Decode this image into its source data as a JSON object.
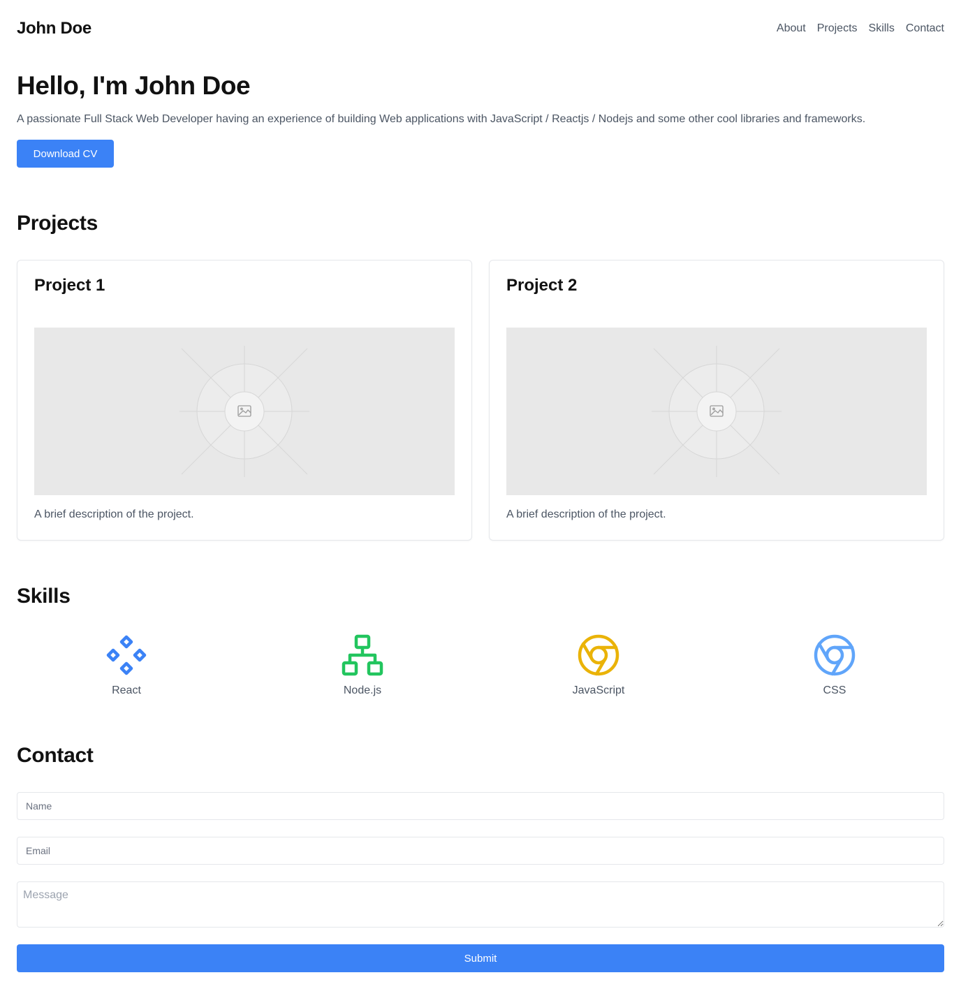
{
  "header": {
    "brand": "John Doe",
    "nav": [
      "About",
      "Projects",
      "Skills",
      "Contact"
    ]
  },
  "hero": {
    "title": "Hello, I'm John Doe",
    "description": "A passionate Full Stack Web Developer having an experience of building Web applications with JavaScript / Reactjs / Nodejs and some other cool libraries and frameworks.",
    "cta_label": "Download CV"
  },
  "projects": {
    "title": "Projects",
    "items": [
      {
        "title": "Project 1",
        "description": "A brief description of the project.",
        "image_icon": "image-placeholder-icon"
      },
      {
        "title": "Project 2",
        "description": "A brief description of the project.",
        "image_icon": "image-placeholder-icon"
      }
    ]
  },
  "skills": {
    "title": "Skills",
    "items": [
      {
        "label": "React",
        "icon": "component-icon",
        "color": "#3b82f6"
      },
      {
        "label": "Node.js",
        "icon": "sitemap-icon",
        "color": "#22c55e"
      },
      {
        "label": "JavaScript",
        "icon": "chrome-icon",
        "color": "#eab308"
      },
      {
        "label": "CSS",
        "icon": "chrome-icon",
        "color": "#60a5fa"
      }
    ]
  },
  "contact": {
    "title": "Contact",
    "name_placeholder": "Name",
    "email_placeholder": "Email",
    "message_placeholder": "Message",
    "submit_label": "Submit"
  },
  "colors": {
    "accent": "#3b82f6",
    "muted_text": "#4b5563",
    "placeholder_bg": "#e8e8e8"
  }
}
